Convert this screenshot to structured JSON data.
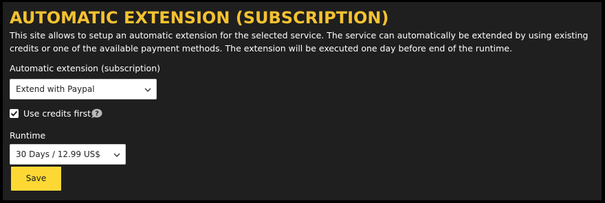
{
  "page": {
    "title": "AUTOMATIC EXTENSION (SUBSCRIPTION)",
    "description": "This site allows to setup an automatic extension for the selected service. The service can automatically be extended by using existing credits or one of the available payment methods. The extension will be executed one day before end of the runtime."
  },
  "extension": {
    "label": "Automatic extension (subscription)",
    "selected": "Extend with Paypal"
  },
  "credits": {
    "label": "Use credits first",
    "checked": true,
    "help_icon": "question-speech-bubble"
  },
  "runtime": {
    "label": "Runtime",
    "selected": "30 Days / 12.99 US$"
  },
  "actions": {
    "save_label": "Save"
  },
  "colors": {
    "accent": "#f5c230",
    "button": "#fdd835",
    "panel_background": "#1f1f1f",
    "page_background": "#000000"
  }
}
